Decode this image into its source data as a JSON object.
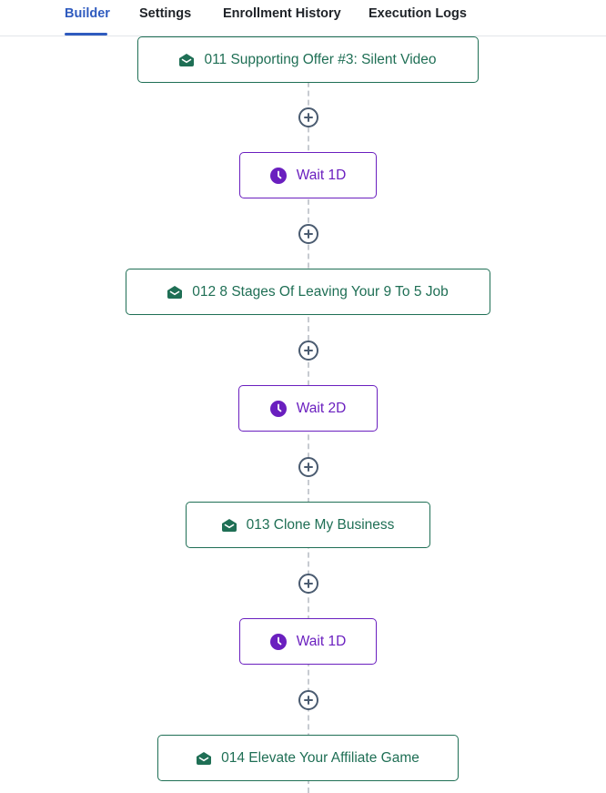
{
  "tabs": [
    {
      "label": "Builder",
      "active": true
    },
    {
      "label": "Settings",
      "active": false
    },
    {
      "label": "Enrollment History",
      "active": false
    },
    {
      "label": "Execution Logs",
      "active": false
    }
  ],
  "colors": {
    "accent": "#2f5bbf",
    "email_node": "#1f6f55",
    "wait_node": "#6a1fbf",
    "add_button": "#4a5b70"
  },
  "workflow": {
    "nodes": [
      {
        "type": "email",
        "icon": "envelope-open-icon",
        "label": "011 Supporting Offer #3: Silent Video"
      },
      {
        "type": "wait",
        "icon": "clock-icon",
        "label": "Wait 1D"
      },
      {
        "type": "email",
        "icon": "envelope-open-icon",
        "label": "012 8 Stages Of Leaving Your 9 To 5 Job"
      },
      {
        "type": "wait",
        "icon": "clock-icon",
        "label": "Wait 2D"
      },
      {
        "type": "email",
        "icon": "envelope-open-icon",
        "label": "013 Clone My Business"
      },
      {
        "type": "wait",
        "icon": "clock-icon",
        "label": "Wait 1D"
      },
      {
        "type": "email",
        "icon": "envelope-open-icon",
        "label": "014 Elevate Your Affiliate Game"
      }
    ],
    "add_step_icon": "plus-circle-icon"
  }
}
